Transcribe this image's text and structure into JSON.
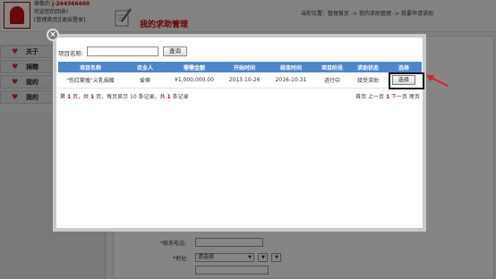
{
  "header": {
    "user_greeting": "尊敬的",
    "user_id": "j-244366460",
    "welcome": "欢迎您的回来!",
    "links": "[管理首页][退出登录]",
    "page_title": "我的求助管理",
    "breadcrumb": "当前位置：管理首页  ->  我的求助管理  ->  我要申请求助"
  },
  "sidebar": {
    "items": [
      {
        "label": "关于"
      },
      {
        "label": "捐赠"
      },
      {
        "label": "我的"
      },
      {
        "label": "我的"
      }
    ]
  },
  "form": {
    "phone_label": "联系电话:",
    "address_label": "地址:",
    "address_select": "请选择"
  },
  "dialog": {
    "close_glyph": "×",
    "search_label": "项目名称:",
    "search_value": "",
    "search_button": "查询",
    "columns": [
      "项目名称",
      "农业人",
      "需需金额",
      "开始时间",
      "结束时间",
      "项目阶段",
      "求助状态",
      "选择"
    ],
    "rows": [
      {
        "name": "\"伤红繁殖\"义乳捐赠",
        "farmer": "爱蒂",
        "amount": "¥1,000,000.00",
        "start": "2013-10-26",
        "end": "2016-10-31",
        "stage": "进行中",
        "status": "接受求助",
        "action": "选择"
      }
    ],
    "pager": {
      "prefix": "第",
      "page": "1",
      "mid1": "页，共",
      "total_pages": "1",
      "mid2": "页，每页显示 10 条记录，共",
      "total_records": "1",
      "suffix": "条记录",
      "first": "首页",
      "prev": "上一页",
      "current": "1",
      "next": "下一页",
      "last": "尾页"
    }
  },
  "colors": {
    "header_blue": "#4f86c9",
    "accent_red": "#c00000"
  }
}
